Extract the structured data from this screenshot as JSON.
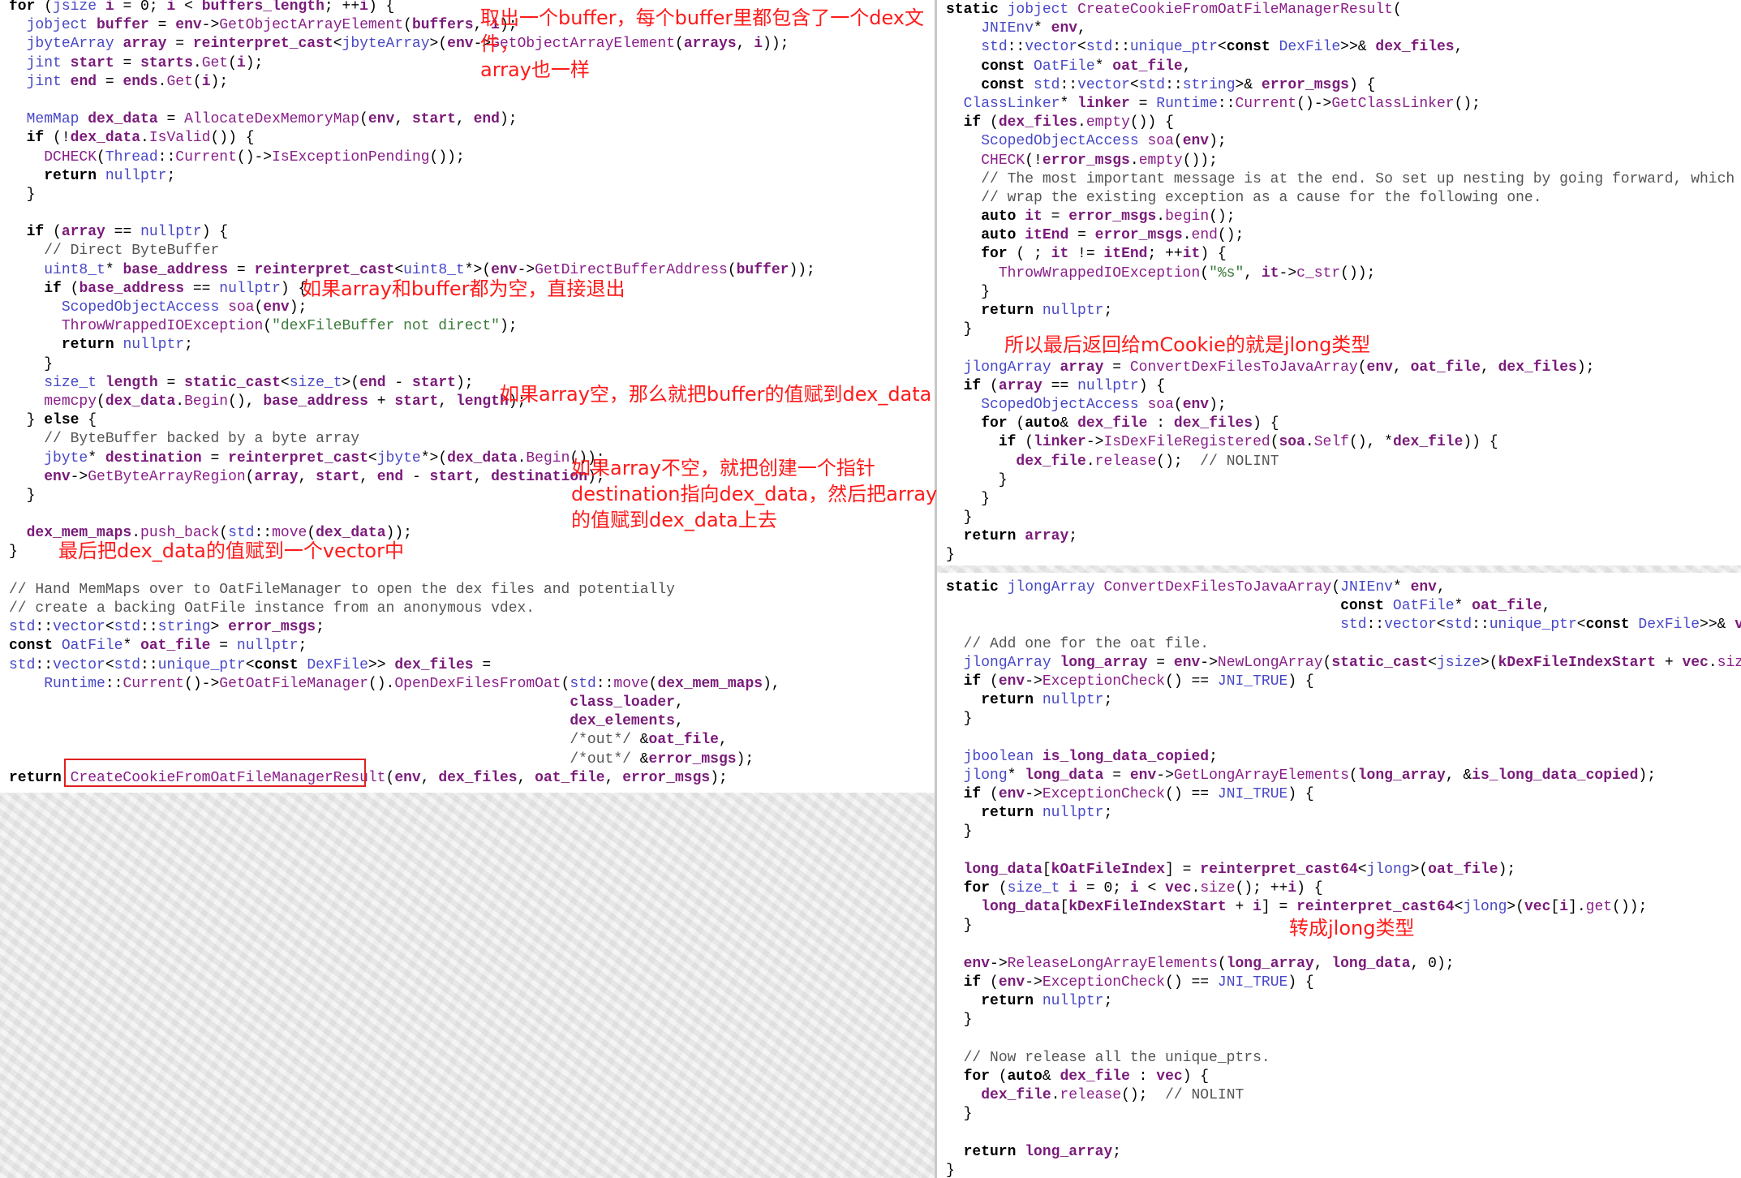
{
  "annotations": {
    "a1_line1": "取出一个buffer，每个buffer里都包含了一个dex文",
    "a1_line2": "件，",
    "a1_line3": "array也一样",
    "a2": "如果array和buffer都为空，直接退出",
    "a3": "如果array空，那么就把buffer的值赋到dex_data",
    "a4_line1": "如果array不空，就把创建一个指针",
    "a4_line2": "destination指向dex_data，然后把array",
    "a4_line3": "的值赋到dex_data上去",
    "a5": "最后把dex_data的值赋到一个vector中",
    "a6": "所以最后返回给mCookie的就是jlong类型",
    "a7": "转成jlong类型"
  },
  "left_code": [
    "for (jsize i = 0; i < buffers_length; ++i) {",
    "  jobject buffer = env->GetObjectArrayElement(buffers, i);",
    "  jbyteArray array = reinterpret_cast<jbyteArray>(env->GetObjectArrayElement(arrays, i));",
    "  jint start = starts.Get(i);",
    "  jint end = ends.Get(i);",
    "",
    "  MemMap dex_data = AllocateDexMemoryMap(env, start, end);",
    "  if (!dex_data.IsValid()) {",
    "    DCHECK(Thread::Current()->IsExceptionPending());",
    "    return nullptr;",
    "  }",
    "",
    "  if (array == nullptr) {",
    "    // Direct ByteBuffer",
    "    uint8_t* base_address = reinterpret_cast<uint8_t*>(env->GetDirectBufferAddress(buffer));",
    "    if (base_address == nullptr) {",
    "      ScopedObjectAccess soa(env);",
    "      ThrowWrappedIOException(\"dexFileBuffer not direct\");",
    "      return nullptr;",
    "    }",
    "    size_t length = static_cast<size_t>(end - start);",
    "    memcpy(dex_data.Begin(), base_address + start, length);",
    "  } else {",
    "    // ByteBuffer backed by a byte array",
    "    jbyte* destination = reinterpret_cast<jbyte*>(dex_data.Begin());",
    "    env->GetByteArrayRegion(array, start, end - start, destination);",
    "  }",
    "",
    "  dex_mem_maps.push_back(std::move(dex_data));",
    "}",
    "",
    "// Hand MemMaps over to OatFileManager to open the dex files and potentially",
    "// create a backing OatFile instance from an anonymous vdex.",
    "std::vector<std::string> error_msgs;",
    "const OatFile* oat_file = nullptr;",
    "std::vector<std::unique_ptr<const DexFile>> dex_files =",
    "    Runtime::Current()->GetOatFileManager().OpenDexFilesFromOat(std::move(dex_mem_maps),",
    "                                                                class_loader,",
    "                                                                dex_elements,",
    "                                                                /*out*/ &oat_file,",
    "                                                                /*out*/ &error_msgs);",
    "return CreateCookieFromOatFileManagerResult(env, dex_files, oat_file, error_msgs);"
  ],
  "right_top_code": [
    "static jobject CreateCookieFromOatFileManagerResult(",
    "    JNIEnv* env,",
    "    std::vector<std::unique_ptr<const DexFile>>& dex_files,",
    "    const OatFile* oat_file,",
    "    const std::vector<std::string>& error_msgs) {",
    "  ClassLinker* linker = Runtime::Current()->GetClassLinker();",
    "  if (dex_files.empty()) {",
    "    ScopedObjectAccess soa(env);",
    "    CHECK(!error_msgs.empty());",
    "    // The most important message is at the end. So set up nesting by going forward, which will",
    "    // wrap the existing exception as a cause for the following one.",
    "    auto it = error_msgs.begin();",
    "    auto itEnd = error_msgs.end();",
    "    for ( ; it != itEnd; ++it) {",
    "      ThrowWrappedIOException(\"%s\", it->c_str());",
    "    }",
    "    return nullptr;",
    "  }",
    "",
    "  jlongArray array = ConvertDexFilesToJavaArray(env, oat_file, dex_files);",
    "  if (array == nullptr) {",
    "    ScopedObjectAccess soa(env);",
    "    for (auto& dex_file : dex_files) {",
    "      if (linker->IsDexFileRegistered(soa.Self(), *dex_file)) {",
    "        dex_file.release();  // NOLINT",
    "      }",
    "    }",
    "  }",
    "  return array;",
    "}"
  ],
  "right_bottom_code": [
    "static jlongArray ConvertDexFilesToJavaArray(JNIEnv* env,",
    "                                             const OatFile* oat_file,",
    "                                             std::vector<std::unique_ptr<const DexFile>>& vec) {",
    "  // Add one for the oat file.",
    "  jlongArray long_array = env->NewLongArray(static_cast<jsize>(kDexFileIndexStart + vec.size()));",
    "  if (env->ExceptionCheck() == JNI_TRUE) {",
    "    return nullptr;",
    "  }",
    "",
    "  jboolean is_long_data_copied;",
    "  jlong* long_data = env->GetLongArrayElements(long_array, &is_long_data_copied);",
    "  if (env->ExceptionCheck() == JNI_TRUE) {",
    "    return nullptr;",
    "  }",
    "",
    "  long_data[kOatFileIndex] = reinterpret_cast64<jlong>(oat_file);",
    "  for (size_t i = 0; i < vec.size(); ++i) {",
    "    long_data[kDexFileIndexStart + i] = reinterpret_cast64<jlong>(vec[i].get());",
    "  }",
    "",
    "  env->ReleaseLongArrayElements(long_array, long_data, 0);",
    "  if (env->ExceptionCheck() == JNI_TRUE) {",
    "    return nullptr;",
    "  }",
    "",
    "  // Now release all the unique_ptrs.",
    "  for (auto& dex_file : vec) {",
    "    dex_file.release();  // NOLINT",
    "  }",
    "",
    "  return long_array;",
    "}"
  ]
}
